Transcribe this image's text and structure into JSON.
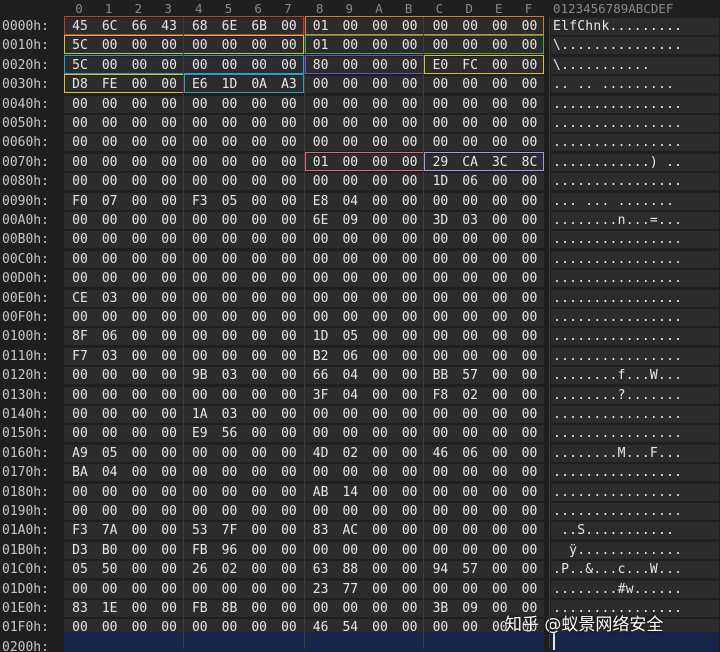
{
  "ascii_header": "0123456789ABCDEF",
  "col_headers": [
    "0",
    "1",
    "2",
    "3",
    "4",
    "5",
    "6",
    "7",
    "8",
    "9",
    "A",
    "B",
    "C",
    "D",
    "E",
    "F"
  ],
  "rows": [
    {
      "addr": "0000h:",
      "hex": "45 6C 66 43 68 6E 6B 00 01 00 00 00 00 00 00 00",
      "ascii": "ElfChnk........."
    },
    {
      "addr": "0010h:",
      "hex": "5C 00 00 00 00 00 00 00 01 00 00 00 00 00 00 00",
      "ascii": "\\..............."
    },
    {
      "addr": "0020h:",
      "hex": "5C 00 00 00 00 00 00 00 80 00 00 00 E0 FC 00 00",
      "ascii": "\\..........."
    },
    {
      "addr": "0030h:",
      "hex": "D8 FE 00 00 E6 1D 0A A3 00 00 00 00 00 00 00 00",
      "ascii": ".. .. ........."
    },
    {
      "addr": "0040h:",
      "hex": "00 00 00 00 00 00 00 00 00 00 00 00 00 00 00 00",
      "ascii": "................"
    },
    {
      "addr": "0050h:",
      "hex": "00 00 00 00 00 00 00 00 00 00 00 00 00 00 00 00",
      "ascii": "................"
    },
    {
      "addr": "0060h:",
      "hex": "00 00 00 00 00 00 00 00 00 00 00 00 00 00 00 00",
      "ascii": "................"
    },
    {
      "addr": "0070h:",
      "hex": "00 00 00 00 00 00 00 00 01 00 00 00 29 CA 3C 8C",
      "ascii": "............) .."
    },
    {
      "addr": "0080h:",
      "hex": "00 00 00 00 00 00 00 00 00 00 00 00 1D 06 00 00",
      "ascii": "................"
    },
    {
      "addr": "0090h:",
      "hex": "F0 07 00 00 F3 05 00 00 E8 04 00 00 00 00 00 00",
      "ascii": "... ... ......."
    },
    {
      "addr": "00A0h:",
      "hex": "00 00 00 00 00 00 00 00 6E 09 00 00 3D 03 00 00",
      "ascii": "........n...=..."
    },
    {
      "addr": "00B0h:",
      "hex": "00 00 00 00 00 00 00 00 00 00 00 00 00 00 00 00",
      "ascii": "................"
    },
    {
      "addr": "00C0h:",
      "hex": "00 00 00 00 00 00 00 00 00 00 00 00 00 00 00 00",
      "ascii": "................"
    },
    {
      "addr": "00D0h:",
      "hex": "00 00 00 00 00 00 00 00 00 00 00 00 00 00 00 00",
      "ascii": "................"
    },
    {
      "addr": "00E0h:",
      "hex": "CE 03 00 00 00 00 00 00 00 00 00 00 00 00 00 00",
      "ascii": "................"
    },
    {
      "addr": "00F0h:",
      "hex": "00 00 00 00 00 00 00 00 00 00 00 00 00 00 00 00",
      "ascii": "................"
    },
    {
      "addr": "0100h:",
      "hex": "8F 06 00 00 00 00 00 00 1D 05 00 00 00 00 00 00",
      "ascii": "................"
    },
    {
      "addr": "0110h:",
      "hex": "F7 03 00 00 00 00 00 00 B2 06 00 00 00 00 00 00",
      "ascii": "................"
    },
    {
      "addr": "0120h:",
      "hex": "00 00 00 00 9B 03 00 00 66 04 00 00 BB 57 00 00",
      "ascii": "........f...W..."
    },
    {
      "addr": "0130h:",
      "hex": "00 00 00 00 00 00 00 00 3F 04 00 00 F8 02 00 00",
      "ascii": "........?......."
    },
    {
      "addr": "0140h:",
      "hex": "00 00 00 00 1A 03 00 00 00 00 00 00 00 00 00 00",
      "ascii": "................"
    },
    {
      "addr": "0150h:",
      "hex": "00 00 00 00 E9 56 00 00 00 00 00 00 00 00 00 00",
      "ascii": "................"
    },
    {
      "addr": "0160h:",
      "hex": "A9 05 00 00 00 00 00 00 4D 02 00 00 46 06 00 00",
      "ascii": "........M...F..."
    },
    {
      "addr": "0170h:",
      "hex": "BA 04 00 00 00 00 00 00 00 00 00 00 00 00 00 00",
      "ascii": "................"
    },
    {
      "addr": "0180h:",
      "hex": "00 00 00 00 00 00 00 00 AB 14 00 00 00 00 00 00",
      "ascii": "................"
    },
    {
      "addr": "0190h:",
      "hex": "00 00 00 00 00 00 00 00 00 00 00 00 00 00 00 00",
      "ascii": "................"
    },
    {
      "addr": "01A0h:",
      "hex": "F3 7A 00 00 53 7F 00 00 83 AC 00 00 00 00 00 00",
      "ascii": " ..S..........."
    },
    {
      "addr": "01B0h:",
      "hex": "D3 B0 00 00 FB 96 00 00 00 00 00 00 00 00 00 00",
      "ascii": "  ÿ............."
    },
    {
      "addr": "01C0h:",
      "hex": "05 50 00 00 26 02 00 00 63 88 00 00 94 57 00 00",
      "ascii": ".P..&...c...W..."
    },
    {
      "addr": "01D0h:",
      "hex": "00 00 00 00 00 00 00 00 23 77 00 00 00 00 00 00",
      "ascii": "........#w......"
    },
    {
      "addr": "01E0h:",
      "hex": "83 1E 00 00 FB 8B 00 00 00 00 00 00 3B 09 00 00",
      "ascii": "................"
    },
    {
      "addr": "01F0h:",
      "hex": "00 00 00 00 00 00 00 00 46 54 00 00 00 00 00 00",
      "ascii": ""
    },
    {
      "addr": "0200h:",
      "hex": "",
      "ascii": ""
    }
  ],
  "watermark": "知乎 @蚁景网络安全",
  "colors": {
    "red": "#c93a3a",
    "orange": "#e07b22",
    "yellow": "#d6c22a",
    "green": "#4fa83a",
    "cyan": "#2aa0c4",
    "purple": "#6a4fd6",
    "pink": "#d86b7a",
    "lavender": "#a49ae0"
  }
}
